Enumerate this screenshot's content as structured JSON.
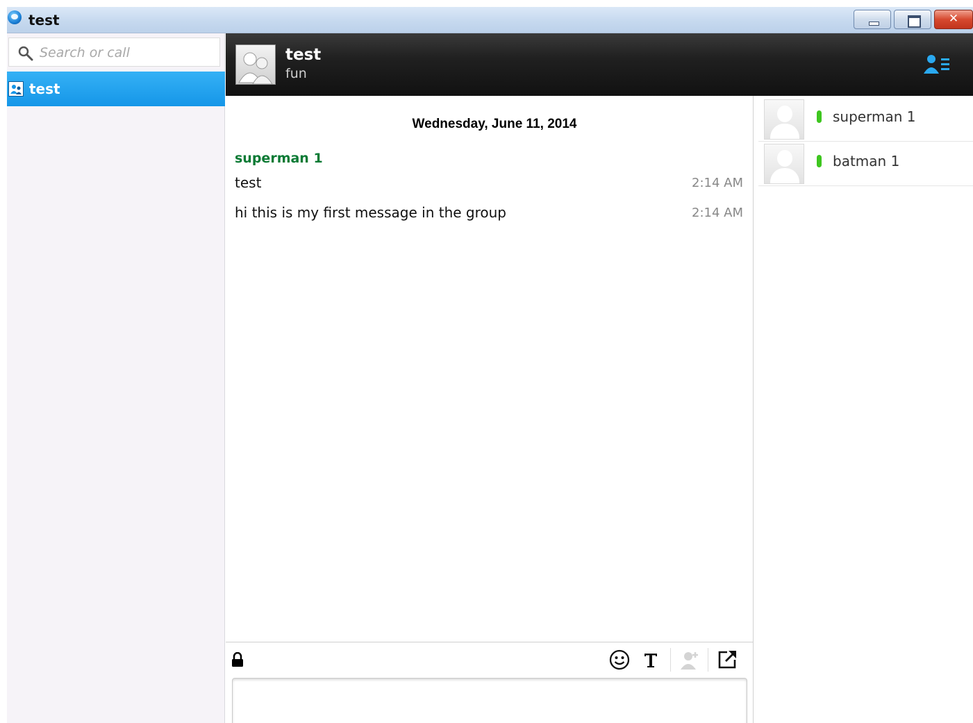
{
  "window": {
    "title": "test"
  },
  "sidebar": {
    "search_placeholder": "Search or call",
    "conversations": [
      {
        "label": "test"
      }
    ]
  },
  "conversation": {
    "name": "test",
    "topic": "fun"
  },
  "chat": {
    "date_separator": "Wednesday, June 11, 2014",
    "sender": "superman 1",
    "messages": [
      {
        "text": "test",
        "time": "2:14 AM"
      },
      {
        "text": "hi this is my first message in the group",
        "time": "2:14 AM"
      }
    ]
  },
  "participants": [
    {
      "name": "superman 1",
      "status": "online"
    },
    {
      "name": "batman 1",
      "status": "online"
    }
  ],
  "colors": {
    "accent": "#1596e8",
    "sender_name": "#0a7a34",
    "status_online": "#3ec61f"
  },
  "icons": {
    "app": "skype-icon",
    "search": "search-icon",
    "participants_toggle": "participants-icon",
    "lock": "lock-icon",
    "emoticon": "emoticon-icon",
    "text_format": "text-format-icon",
    "add_people": "add-people-icon",
    "popout": "popout-icon"
  }
}
